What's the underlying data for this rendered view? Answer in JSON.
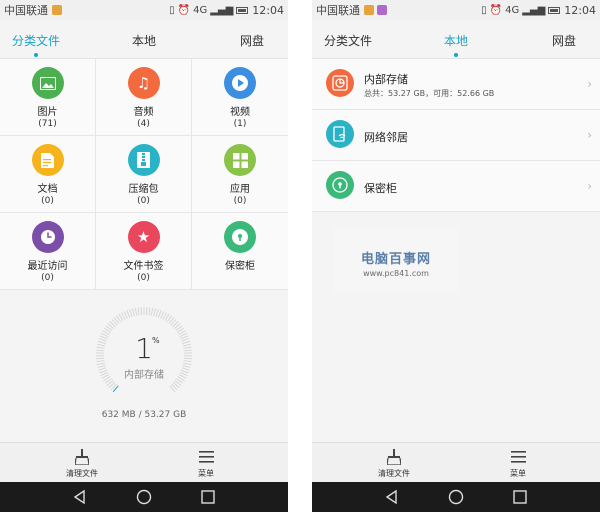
{
  "status_bar": {
    "carrier": "中国联通",
    "network": "4G",
    "time": "12:04"
  },
  "left_screen": {
    "tabs": [
      {
        "label": "分类文件",
        "active": true
      },
      {
        "label": "本地",
        "active": false
      },
      {
        "label": "网盘",
        "active": false
      }
    ],
    "categories": [
      {
        "label": "图片",
        "count": "(71)",
        "icon": "image-icon",
        "color": "#4caf50"
      },
      {
        "label": "音频",
        "count": "(4)",
        "icon": "music-icon",
        "color": "#f36a3f"
      },
      {
        "label": "视频",
        "count": "(1)",
        "icon": "play-icon",
        "color": "#3c8fe0"
      },
      {
        "label": "文档",
        "count": "(0)",
        "icon": "document-icon",
        "color": "#f5b41e"
      },
      {
        "label": "压缩包",
        "count": "(0)",
        "icon": "archive-icon",
        "color": "#2ab3c7"
      },
      {
        "label": "应用",
        "count": "(0)",
        "icon": "apps-icon",
        "color": "#8bc34a"
      },
      {
        "label": "最近访问",
        "count": "(0)",
        "icon": "clock-icon",
        "color": "#7b4fa8"
      },
      {
        "label": "文件书签",
        "count": "(0)",
        "icon": "star-icon",
        "color": "#e8475d"
      },
      {
        "label": "保密柜",
        "count": "",
        "icon": "lock-icon",
        "color": "#3bb87a"
      }
    ],
    "storage": {
      "percent": "1",
      "percent_sign": "%",
      "label": "内部存储",
      "size": "632 MB / 53.27 GB"
    },
    "actions": [
      {
        "label": "清理文件",
        "icon": "broom-icon"
      },
      {
        "label": "菜单",
        "icon": "menu-icon"
      }
    ]
  },
  "right_screen": {
    "tabs": [
      {
        "label": "分类文件",
        "active": false
      },
      {
        "label": "本地",
        "active": true
      },
      {
        "label": "网盘",
        "active": false
      }
    ],
    "items": [
      {
        "title": "内部存储",
        "subtitle": "总共：53.27 GB，可用：52.66 GB",
        "icon": "storage-icon",
        "color": "#f36a3f"
      },
      {
        "title": "网络邻居",
        "subtitle": "",
        "icon": "network-icon",
        "color": "#2ab3c7"
      },
      {
        "title": "保密柜",
        "subtitle": "",
        "icon": "lock-icon",
        "color": "#3bb87a"
      }
    ],
    "watermark": {
      "title": "电脑百事网",
      "url": "www.pc841.com"
    },
    "actions": [
      {
        "label": "清理文件",
        "icon": "broom-icon"
      },
      {
        "label": "菜单",
        "icon": "menu-icon"
      }
    ]
  },
  "colors": {
    "accent": "#18a5c8",
    "nav_bar": "#1b1b1b"
  }
}
